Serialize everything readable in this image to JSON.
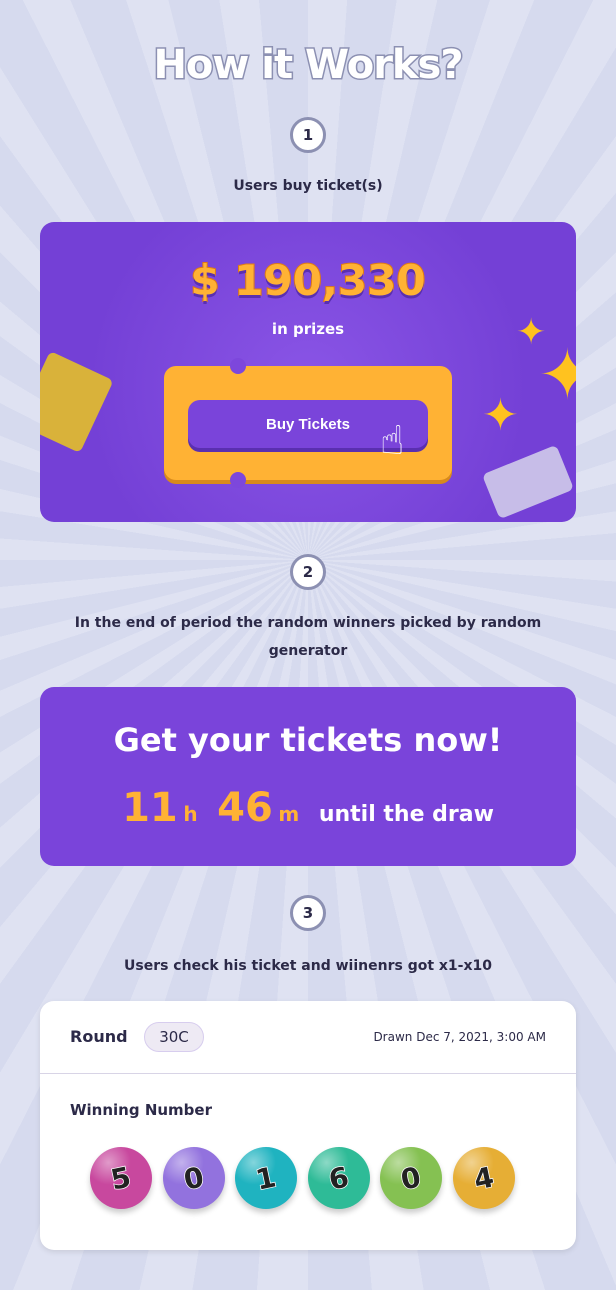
{
  "title": "How it Works?",
  "steps": [
    {
      "number": "1",
      "caption": "Users buy ticket(s)"
    },
    {
      "number": "2",
      "caption": "In the end of period the random winners picked by random generator"
    },
    {
      "number": "3",
      "caption": "Users check his ticket and wiinenrs got x1-x10"
    }
  ],
  "prize_card": {
    "amount": "$ 190,330",
    "subtitle": "in prizes",
    "buy_label": "Buy Tickets"
  },
  "countdown_card": {
    "headline": "Get your tickets now!",
    "hours": "11",
    "hours_unit": "h",
    "minutes": "46",
    "minutes_unit": "m",
    "suffix": "until the draw"
  },
  "result_card": {
    "round_label": "Round",
    "round_value": "30C",
    "drawn": "Drawn Dec 7, 2021, 3:00 AM",
    "winning_label": "Winning Number",
    "balls": [
      {
        "digit": "5",
        "color": "#c8489e"
      },
      {
        "digit": "0",
        "color": "#9272de"
      },
      {
        "digit": "1",
        "color": "#1fb3c0"
      },
      {
        "digit": "6",
        "color": "#2ebb97"
      },
      {
        "digit": "0",
        "color": "#85c152"
      },
      {
        "digit": "4",
        "color": "#e6ae35"
      }
    ]
  },
  "colors": {
    "accent": "#7a44da",
    "yellow": "#ffb234"
  }
}
